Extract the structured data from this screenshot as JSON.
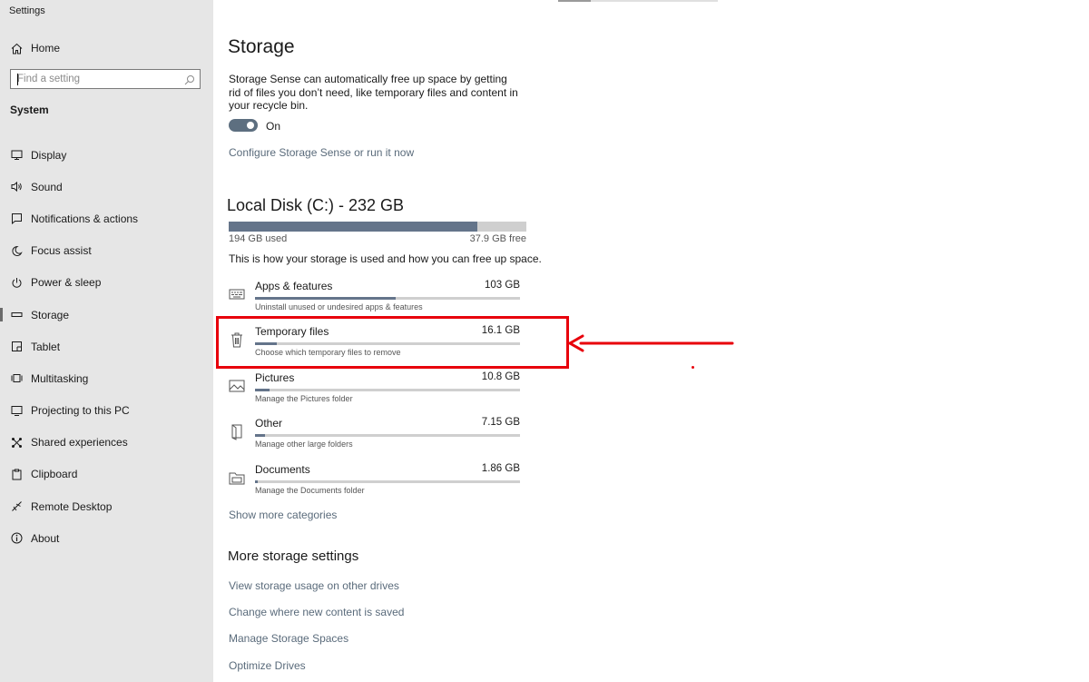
{
  "window": {
    "title": "Settings"
  },
  "sidebar": {
    "home_label": "Home",
    "search": {
      "placeholder": "Find a setting",
      "value": ""
    },
    "section_heading": "System",
    "items": [
      {
        "label": "Display",
        "icon": "display-icon",
        "active": false
      },
      {
        "label": "Sound",
        "icon": "sound-icon",
        "active": false
      },
      {
        "label": "Notifications & actions",
        "icon": "notifications-icon",
        "active": false
      },
      {
        "label": "Focus assist",
        "icon": "moon-icon",
        "active": false
      },
      {
        "label": "Power & sleep",
        "icon": "power-icon",
        "active": false
      },
      {
        "label": "Storage",
        "icon": "storage-icon",
        "active": true
      },
      {
        "label": "Tablet",
        "icon": "tablet-icon",
        "active": false
      },
      {
        "label": "Multitasking",
        "icon": "multitasking-icon",
        "active": false
      },
      {
        "label": "Projecting to this PC",
        "icon": "projecting-icon",
        "active": false
      },
      {
        "label": "Shared experiences",
        "icon": "shared-icon",
        "active": false
      },
      {
        "label": "Clipboard",
        "icon": "clipboard-icon",
        "active": false
      },
      {
        "label": "Remote Desktop",
        "icon": "remote-desktop-icon",
        "active": false
      },
      {
        "label": "About",
        "icon": "info-icon",
        "active": false
      }
    ]
  },
  "main": {
    "title": "Storage",
    "description": "Storage Sense can automatically free up space by getting rid of files you don’t need, like temporary files and content in your recycle bin.",
    "storage_sense": {
      "state": "On",
      "enabled": true
    },
    "configure_link": "Configure Storage Sense or run it now",
    "disk": {
      "title": "Local Disk (C:) - 232 GB",
      "used_label": "194 GB used",
      "free_label": "37.9 GB free",
      "used_fraction": 0.836
    },
    "usage_text": "This is how your storage is used and how you can free up space.",
    "categories": [
      {
        "name": "Apps & features",
        "size": "103 GB",
        "description": "Uninstall unused or undesired apps & features",
        "fraction": 0.53,
        "icon": "keyboard-icon"
      },
      {
        "name": "Temporary files",
        "size": "16.1 GB",
        "description": "Choose which temporary files to remove",
        "fraction": 0.083,
        "icon": "trash-icon"
      },
      {
        "name": "Pictures",
        "size": "10.8 GB",
        "description": "Manage the Pictures folder",
        "fraction": 0.056,
        "icon": "picture-icon"
      },
      {
        "name": "Other",
        "size": "7.15 GB",
        "description": "Manage other large folders",
        "fraction": 0.037,
        "icon": "other-icon"
      },
      {
        "name": "Documents",
        "size": "1.86 GB",
        "description": "Manage the Documents folder",
        "fraction": 0.01,
        "icon": "documents-icon"
      }
    ],
    "show_more_link": "Show more categories",
    "more_settings": {
      "heading": "More storage settings",
      "links": [
        "View storage usage on other drives",
        "Change where new content is saved",
        "Manage Storage Spaces",
        "Optimize Drives"
      ]
    }
  },
  "annotation": {
    "color": "#e8000b",
    "target": "Temporary files"
  },
  "colors": {
    "sidebar_bg": "#e6e6e6",
    "accent_bar": "#64748a",
    "link": "#5a6b7b"
  }
}
